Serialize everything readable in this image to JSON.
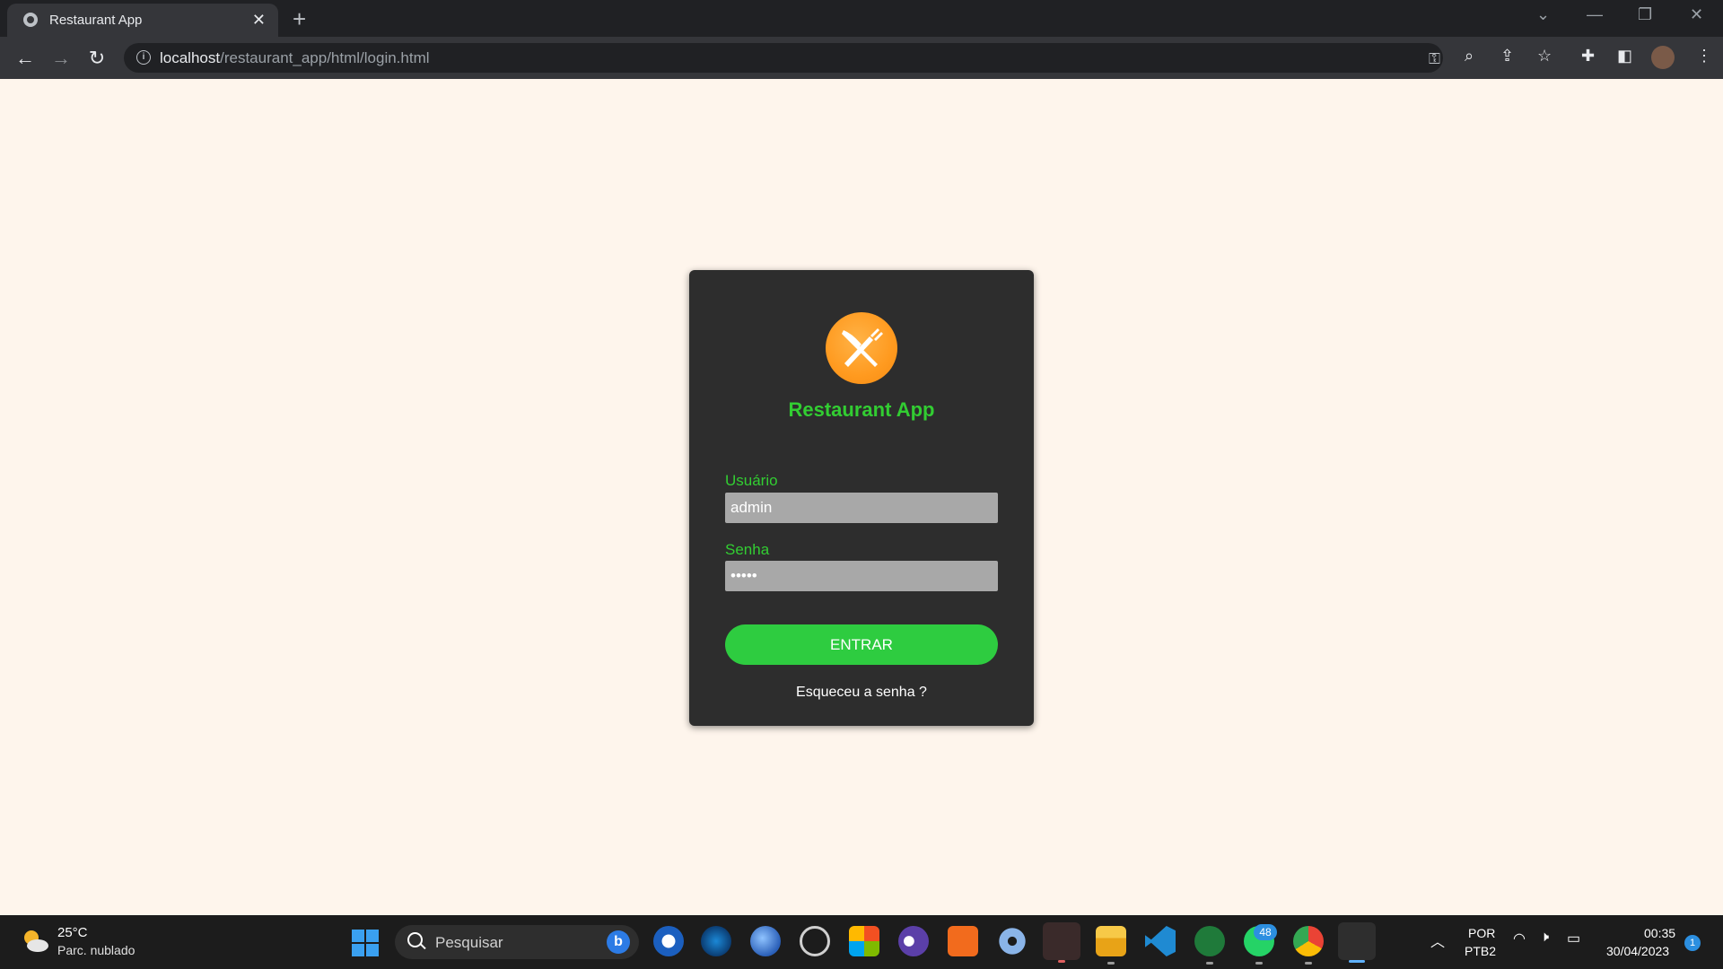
{
  "browser": {
    "tab_title": "Restaurant App",
    "url_host": "localhost",
    "url_path": "/restaurant_app/html/login.html"
  },
  "login": {
    "app_title": "Restaurant App",
    "user_label": "Usuário",
    "user_value": "admin",
    "password_label": "Senha",
    "password_value": "admin",
    "submit_label": "ENTRAR",
    "forgot_label": "Esqueceu a senha ?"
  },
  "colors": {
    "page_bg": "#fef5ec",
    "card_bg": "#2d2d2d",
    "accent_green": "#32cd32",
    "button_green": "#2ecc40",
    "logo_orange": "#ff9a1f",
    "input_bg": "#a8a8a8"
  },
  "taskbar": {
    "weather_temp": "25°C",
    "weather_desc": "Parc. nublado",
    "search_placeholder": "Pesquisar",
    "whatsapp_badge": "48",
    "lang_line1": "POR",
    "lang_line2": "PTB2",
    "time": "00:35",
    "date": "30/04/2023",
    "notification_count": "1",
    "apps": [
      "bing-icon",
      "app-icon-1",
      "steam-icon",
      "browser-icon",
      "obs-icon",
      "store-icon",
      "eclipse-icon",
      "xampp-icon",
      "settings-icon",
      "terminal-icon",
      "file-explorer-icon",
      "vscode-icon",
      "hs-icon",
      "whatsapp-icon",
      "chrome-icon",
      "snipping-tool-icon"
    ]
  }
}
